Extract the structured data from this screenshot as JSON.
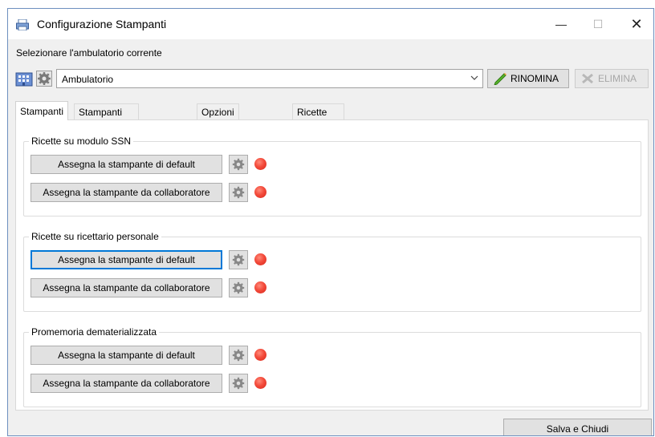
{
  "window": {
    "title": "Configurazione Stampanti",
    "minimize_symbol": "—",
    "maximize_symbol": "☐",
    "close_symbol": "✕"
  },
  "ambulatorio": {
    "label": "Selezionare l'ambulatorio corrente",
    "selected": "Ambulatorio",
    "rename_label": "RINOMINA",
    "delete_label": "ELIMINA"
  },
  "tabs": [
    {
      "label": "Stampanti",
      "active": true
    },
    {
      "label": "Stampanti collaboratore"
    },
    {
      "label": "Opzioni di stampa"
    },
    {
      "label": "Ricette su ricettario personale"
    }
  ],
  "groups": [
    {
      "title": "Ricette su modulo SSN",
      "default_label": "Assegna la stampante di default",
      "collab_label": "Assegna la stampante da collaboratore"
    },
    {
      "title": "Ricette su ricettario personale",
      "default_label": "Assegna la stampante di default",
      "collab_label": "Assegna la stampante da collaboratore"
    },
    {
      "title": "Promemoria dematerializzata",
      "default_label": "Assegna la stampante di default",
      "collab_label": "Assegna la stampante da collaboratore"
    }
  ],
  "footer": {
    "save_label": "Salva e Chiudi"
  },
  "colors": {
    "status_off": "#e8362a",
    "focus_border": "#0078d7"
  },
  "icons": [
    "printer-icon",
    "building-icon",
    "gear-icon",
    "pencil-icon",
    "delete-icon",
    "chevron-down-icon"
  ]
}
